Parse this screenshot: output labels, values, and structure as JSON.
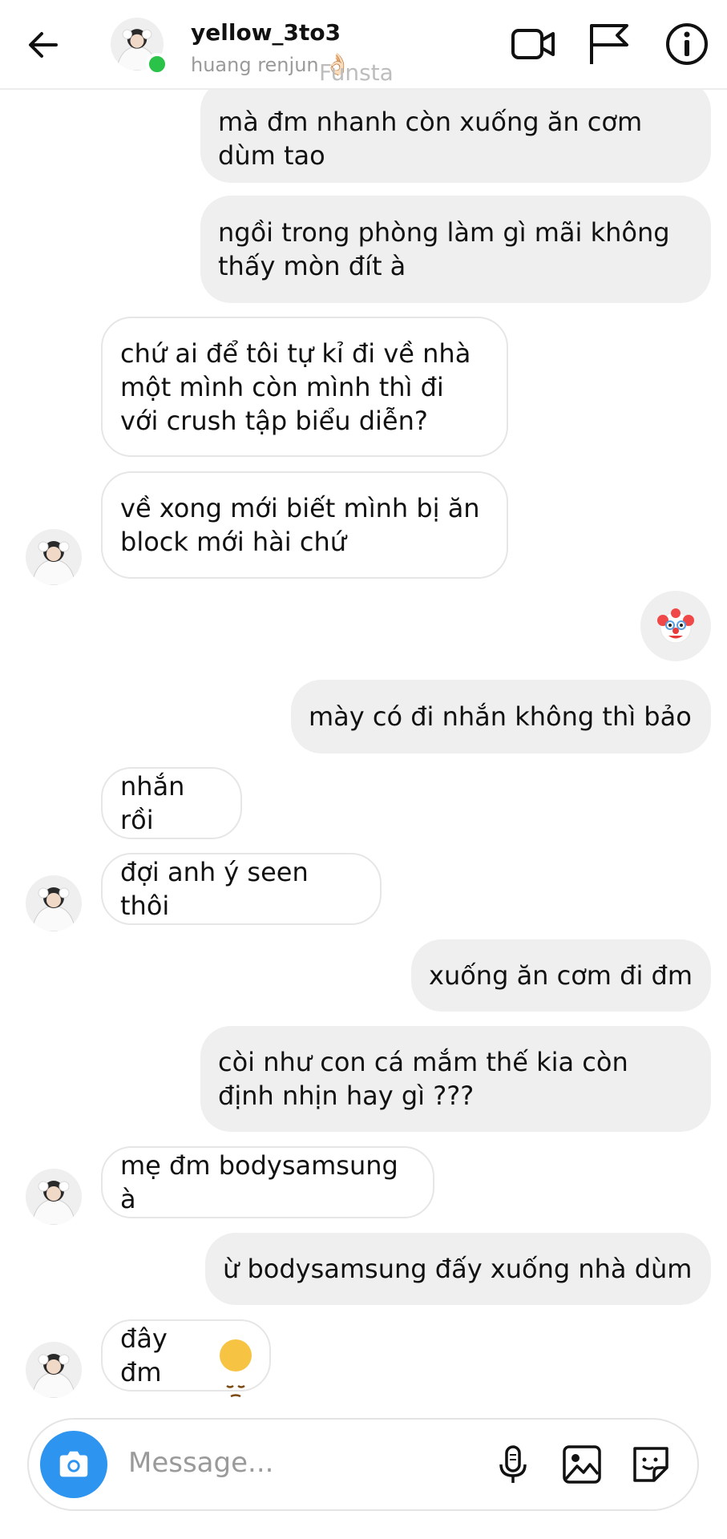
{
  "header": {
    "username": "yellow_3to3",
    "real_name": "huang renjun",
    "real_name_emoji": "👌🏻",
    "watermark": "Funsta"
  },
  "composer": {
    "placeholder": "Message..."
  },
  "colors": {
    "accent": "#2d95f0",
    "online": "#2bc24a",
    "outgoing_bubble": "#efefef"
  },
  "messages": [
    {
      "side": "out",
      "text": "mà đm nhanh còn xuống ăn cơm\ndùm tao"
    },
    {
      "side": "out",
      "text": "ngồi trong phòng làm gì mãi không\nthấy mòn đít à"
    },
    {
      "side": "in",
      "text": "chứ ai để tôi tự kỉ đi về nhà\nmột mình còn mình thì đi\nvới crush tập biểu diễn?"
    },
    {
      "side": "in",
      "text": "về xong mới biết mình bị ăn\nblock mới hài chứ"
    },
    {
      "side": "out",
      "text": "🤡"
    },
    {
      "side": "out",
      "text": "mày có đi nhắn không thì bảo"
    },
    {
      "side": "in",
      "text": "nhắn rồi"
    },
    {
      "side": "in",
      "text": "đợi anh ý seen thôi"
    },
    {
      "side": "out",
      "text": "xuống ăn cơm đi đm"
    },
    {
      "side": "out",
      "text": "còi như con cá mắm thế kia còn\nđịnh nhịn hay gì ???"
    },
    {
      "side": "in",
      "text": "mẹ đm bodysamsung à"
    },
    {
      "side": "out",
      "text": "ừ bodysamsung đấy xuống nhà dùm"
    },
    {
      "side": "in",
      "text": "đây đm"
    }
  ]
}
